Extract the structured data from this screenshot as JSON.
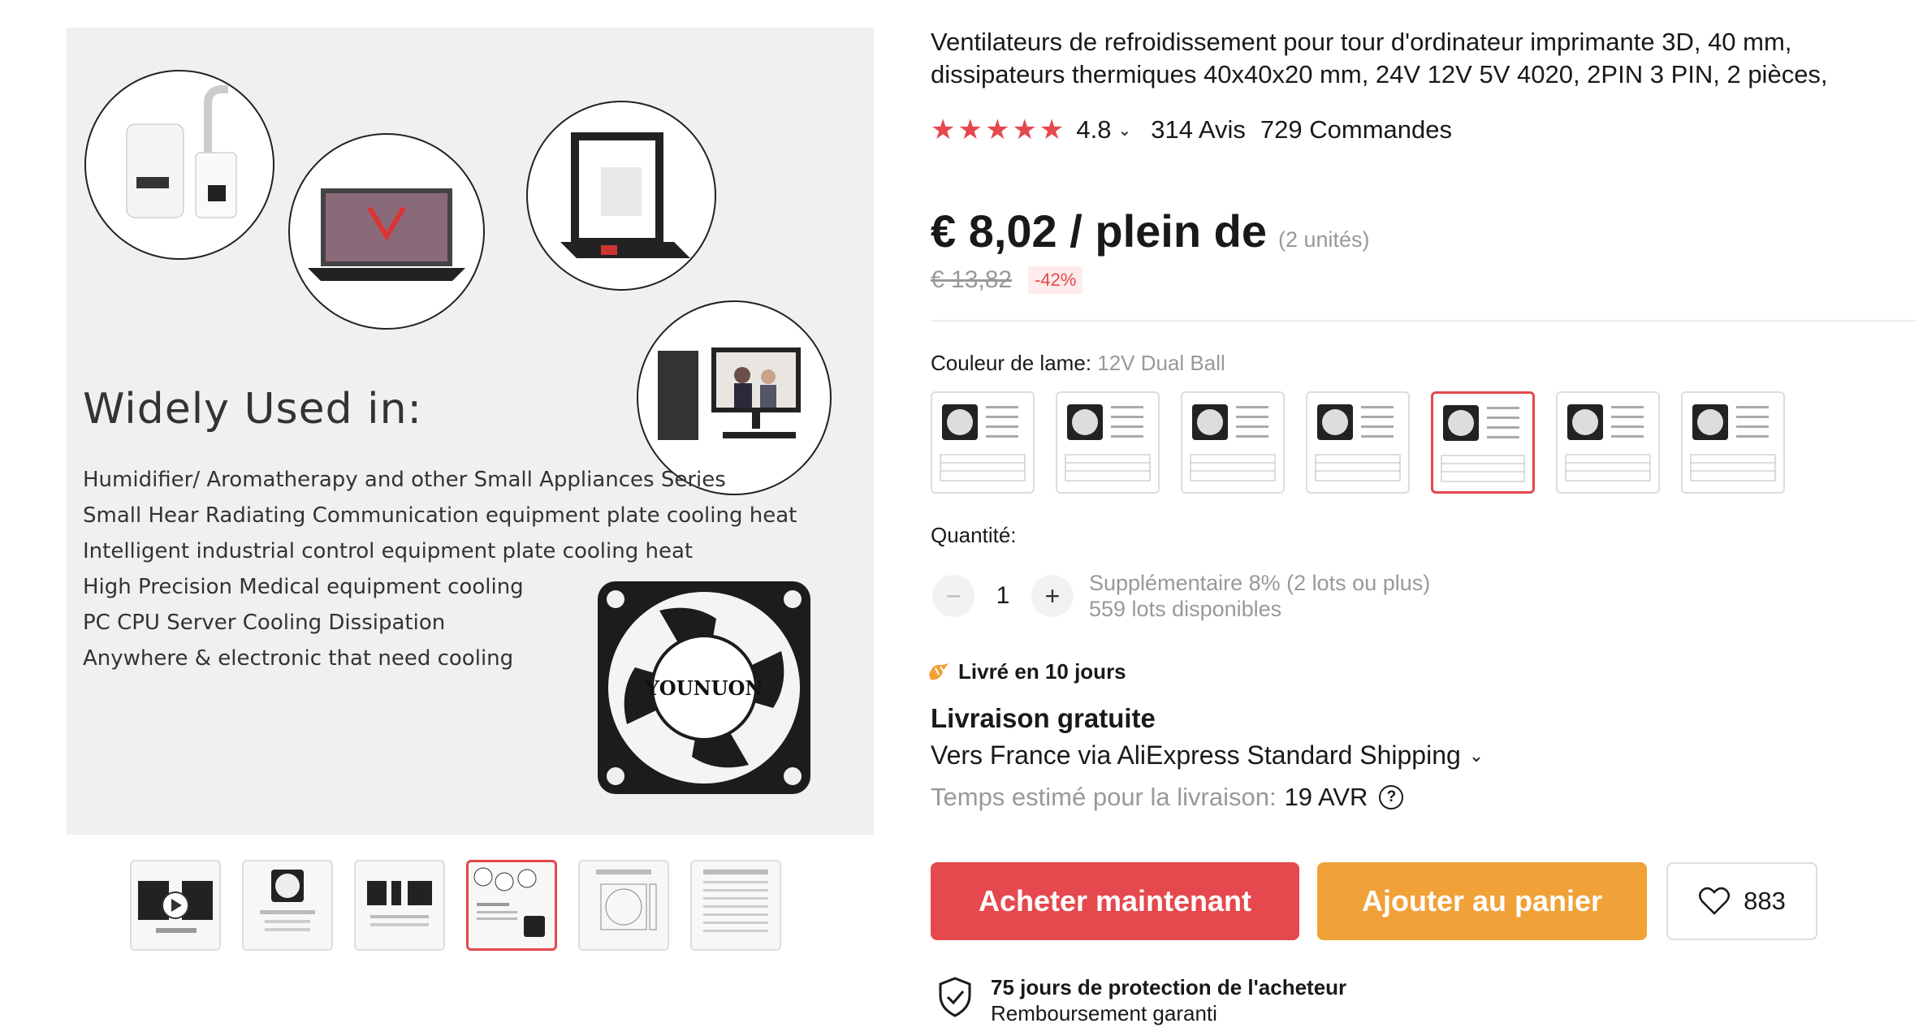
{
  "gallery": {
    "main": {
      "headline": "Widely Used in:",
      "uses": [
        "Humidifier/ Aromatherapy and other Small Appliances Series",
        "Small Hear Radiating Communication equipment plate cooling heat",
        "Intelligent industrial control equipment plate cooling heat",
        "High Precision Medical equipment cooling",
        "PC CPU Server Cooling Dissipation",
        "Anywhere & electronic that need cooling"
      ],
      "fan_brand": "YOUNUON"
    },
    "thumbnails": 6,
    "selected_thumbnail_index": 3
  },
  "product": {
    "title": "Ventilateurs de refroidissement pour tour d'ordinateur imprimante 3D, 40 mm, dissipateurs thermiques 40x40x20 mm, 24V 12V 5V 4020, 2PIN 3 PIN, 2 pièces,",
    "rating": "4.8",
    "stars": 5,
    "reviews": "314 Avis",
    "orders": "729 Commandes"
  },
  "price": {
    "current": "€ 8,02 / plein de",
    "units": "(2 unités)",
    "original": "€ 13,82",
    "discount": "-42%"
  },
  "variants": {
    "label": "Couleur de lame:",
    "selected_value": "12V Dual Ball",
    "count": 7,
    "selected_index": 4
  },
  "quantity": {
    "label": "Quantité:",
    "value": "1",
    "minus": "−",
    "plus": "+",
    "extra": "Supplémentaire 8% (2 lots ou plus)",
    "available": "559 lots disponibles"
  },
  "shipping": {
    "days": "Livré en 10 jours",
    "free": "Livraison gratuite",
    "via": "Vers France via AliExpress Standard Shipping",
    "estimate_label": "Temps estimé pour la livraison:",
    "estimate_date": "19 AVR",
    "help": "?"
  },
  "actions": {
    "buy": "Acheter maintenant",
    "cart": "Ajouter au panier",
    "wishlist_count": "883"
  },
  "protection": {
    "title": "75 jours de protection de l'acheteur",
    "subtitle": "Remboursement garanti"
  },
  "colors": {
    "accent": "#e5484d",
    "cart": "#f0a138",
    "muted": "#999999"
  }
}
